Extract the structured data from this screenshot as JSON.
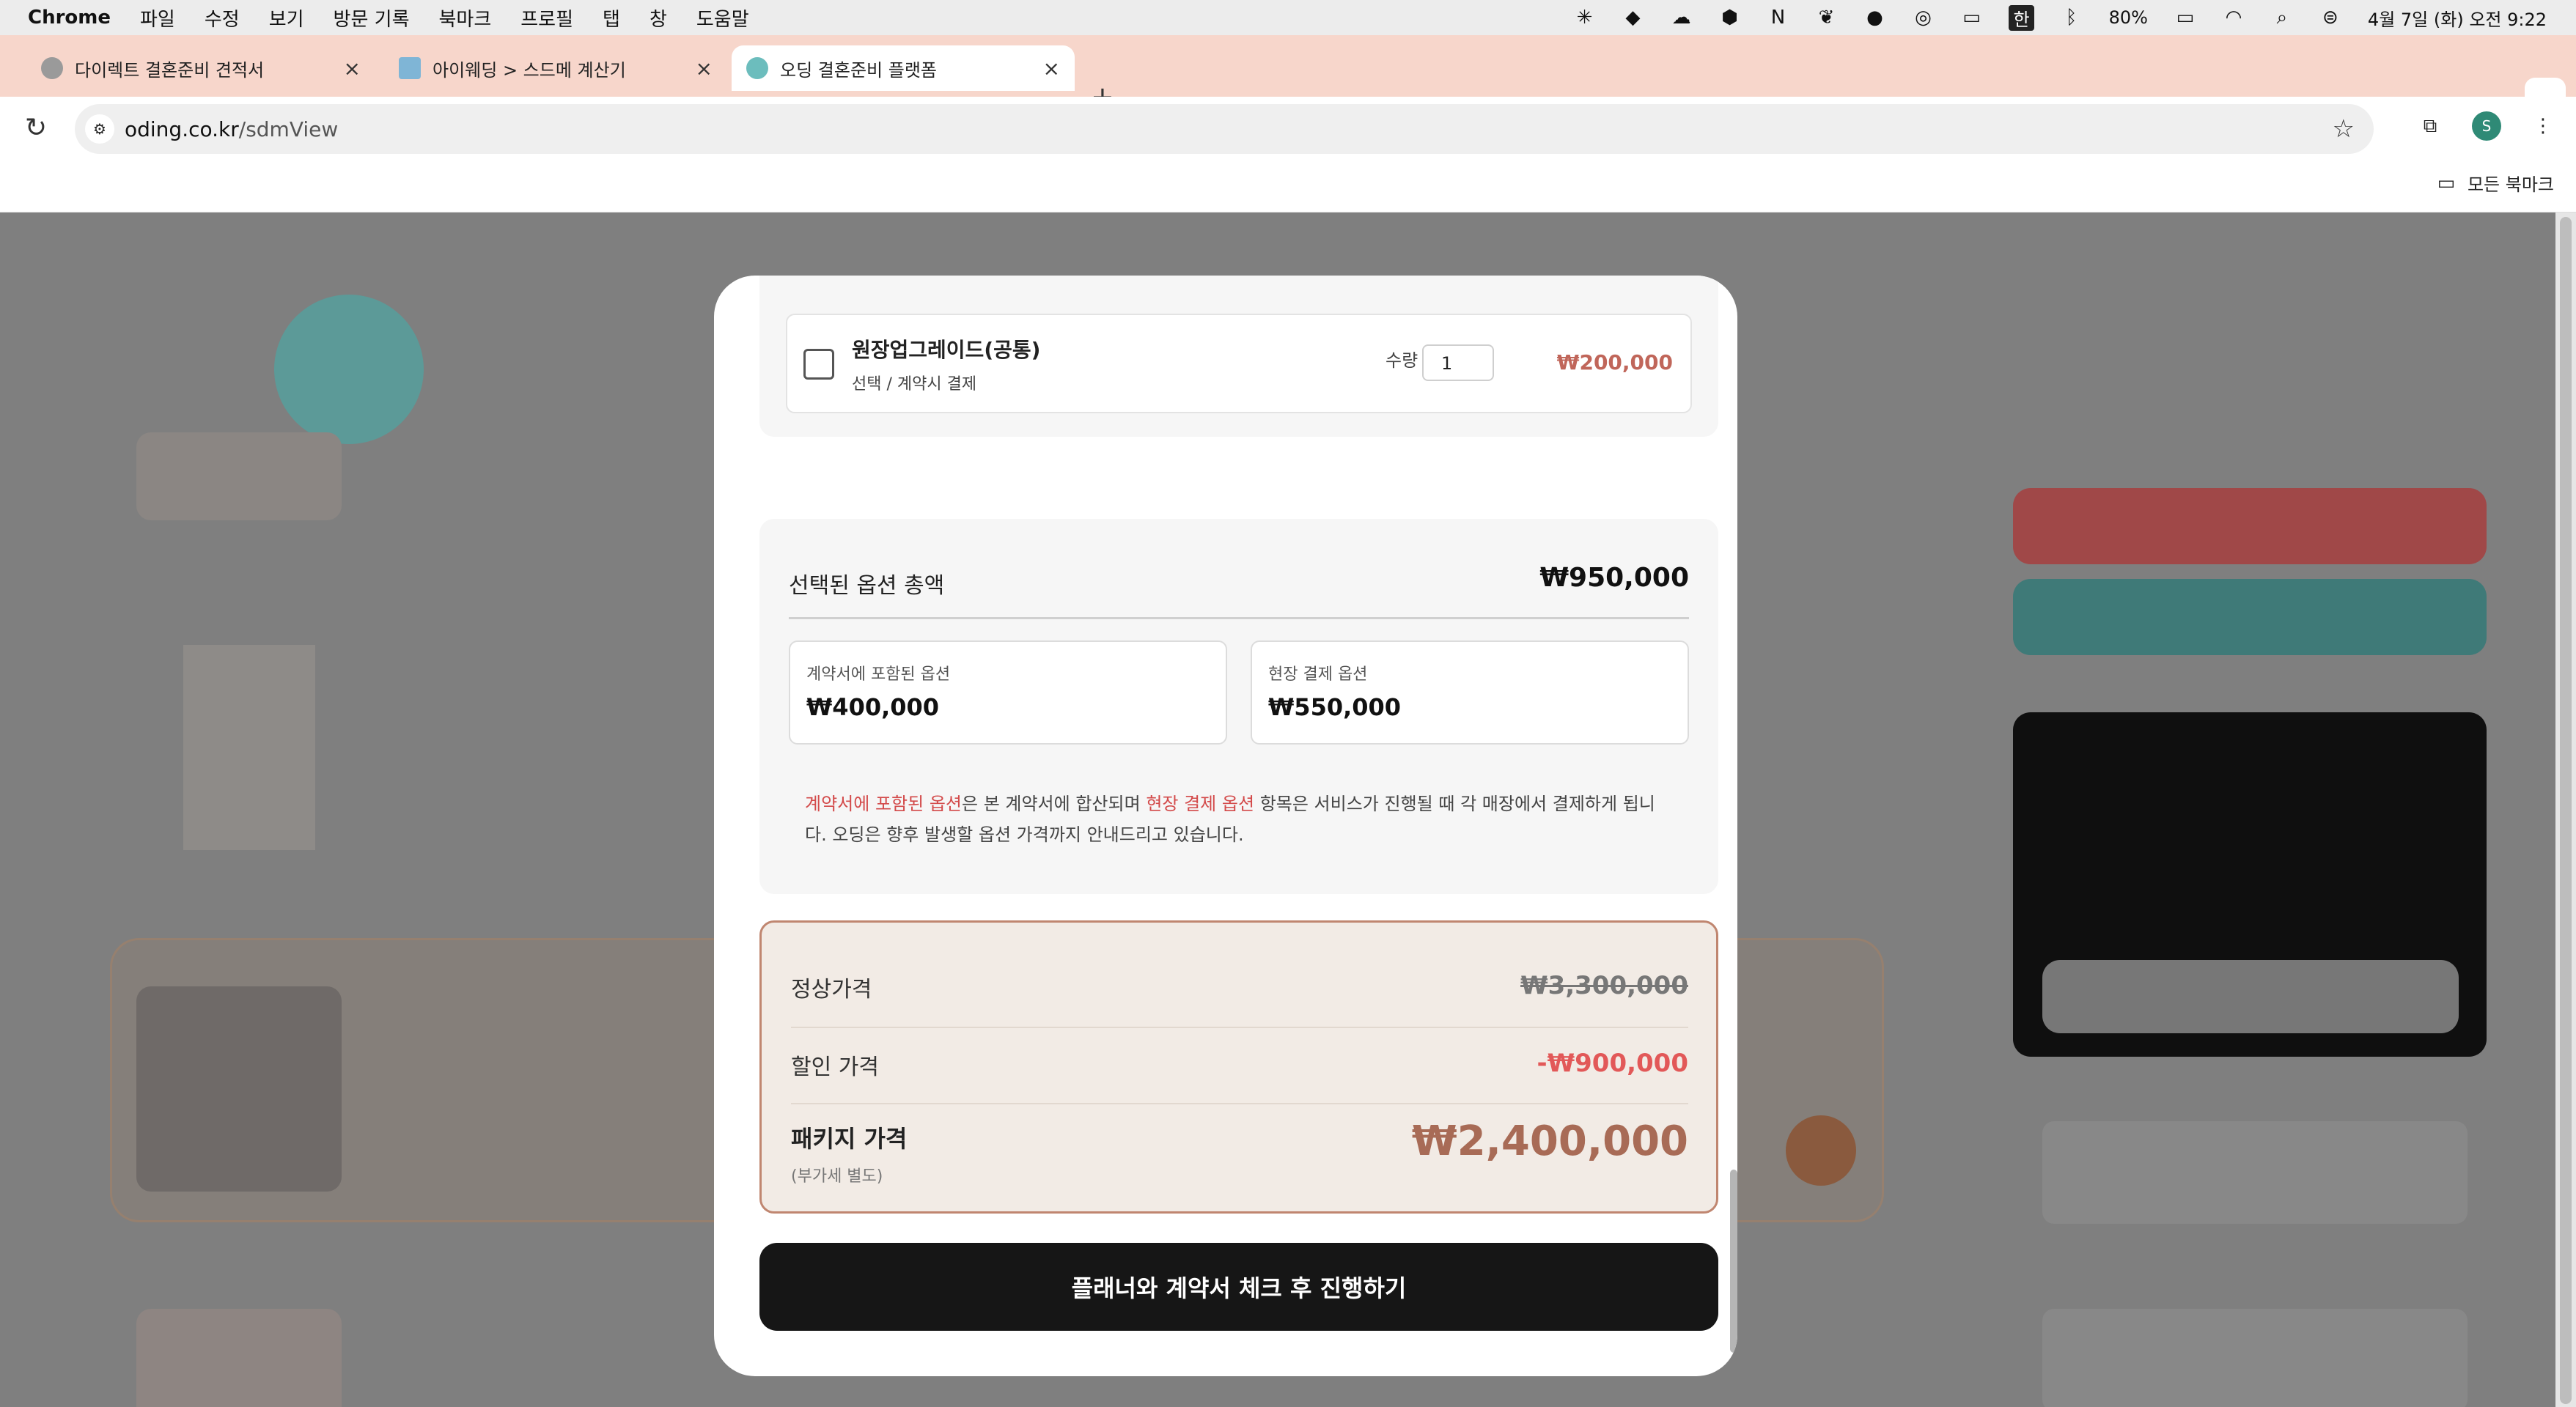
{
  "menubar": {
    "app": "Chrome",
    "items": [
      "파일",
      "수정",
      "보기",
      "방문 기록",
      "북마크",
      "프로필",
      "탭",
      "창",
      "도움말"
    ],
    "status": {
      "battery": "80%",
      "ime": "한",
      "datetime": "4월 7일 (화) 오전 9:22"
    }
  },
  "tabs": [
    {
      "title": "다이렉트 결혼준비 견적서",
      "fav_color": "#9a9a9a"
    },
    {
      "title": "아이웨딩 > 스드메 계산기",
      "fav_color": "#7fb5d6"
    },
    {
      "title": "오딩 결혼준비 플랫폼",
      "fav_color": "#6cbdbd"
    }
  ],
  "address": {
    "domain": "oding.co.kr",
    "path": "/sdmView"
  },
  "bookmarks": {
    "all_label": "모든 북마크"
  },
  "modal": {
    "option": {
      "name": "원장업그레이드(공통)",
      "meta": "선택  / 계약시 결제",
      "qty_label": "수량",
      "qty": "1",
      "price": "₩200,000"
    },
    "total": {
      "label": "선택된 옵션 총액",
      "value": "₩950,000",
      "contract_label": "계약서에 포함된 옵션",
      "contract_value": "₩400,000",
      "onsite_label": "현장 결제 옵션",
      "onsite_value": "₩550,000",
      "note_hl1": "계약서에 포함된 옵션",
      "note_t1": "은 본 계약서에 합산되며 ",
      "note_hl2": "현장 결제 옵션",
      "note_t2": " 항목은 서비스가 진행될 때 각 매장에서 결제하게 됩니다. 오딩은 향후 발생할 옵션 가격까지 안내드리고 있습니다."
    },
    "pricing": {
      "regular_label": "정상가격",
      "regular_value": "₩3,300,000",
      "discount_label": "할인 가격",
      "discount_value": "-₩900,000",
      "package_label": "패키지 가격",
      "vat_note": "(부가세 별도)",
      "package_value": "₩2,400,000"
    },
    "cta": "플래너와 계약서 체크 후 진행하기"
  }
}
